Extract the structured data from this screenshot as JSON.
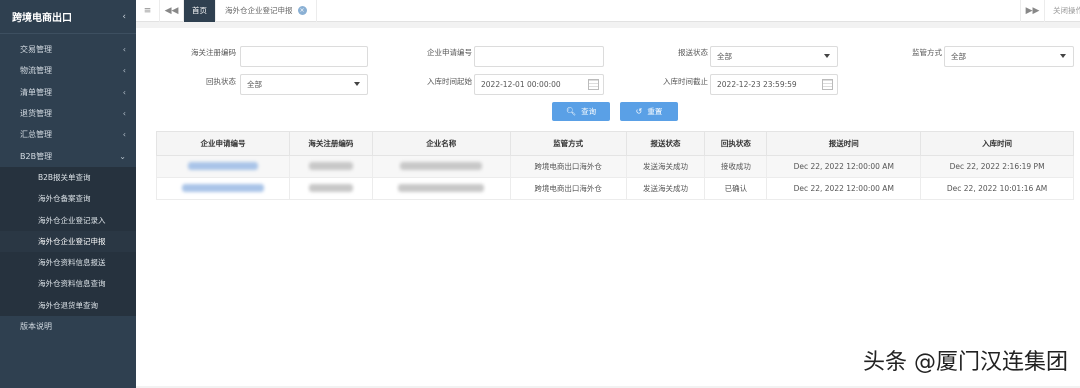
{
  "sidebar": {
    "title": "跨境电商出口",
    "menu": [
      {
        "label": "交易管理"
      },
      {
        "label": "物流管理"
      },
      {
        "label": "清单管理"
      },
      {
        "label": "退货管理"
      },
      {
        "label": "汇总管理"
      },
      {
        "label": "B2B管理"
      }
    ],
    "b2b_children": [
      {
        "label": "B2B报关单查询"
      },
      {
        "label": "海外仓备案查询"
      },
      {
        "label": "海外仓企业登记录入"
      },
      {
        "label": "海外仓企业登记申报"
      },
      {
        "label": "海外仓资料信息报送"
      },
      {
        "label": "海外仓资料信息查询"
      },
      {
        "label": "海外仓退货单查询"
      }
    ],
    "version": "版本说明"
  },
  "topbar": {
    "home_tab": "首页",
    "active_tab": "海外仓企业登记申报",
    "close_ops": "关闭操作"
  },
  "form": {
    "customs_code_label": "海关注册编码",
    "customs_code_value": "",
    "enterprise_no_label": "企业申请编号",
    "enterprise_no_value": "",
    "report_status_label": "报送状态",
    "report_status_value": "全部",
    "supervision_label": "监管方式",
    "supervision_value": "全部",
    "receipt_status_label": "回执状态",
    "receipt_status_value": "全部",
    "entry_start_label": "入库时间起始",
    "entry_start_value": "2022-12-01 00:00:00",
    "entry_end_label": "入库时间截止",
    "entry_end_value": "2022-12-23 23:59:59",
    "query_button": "查询",
    "reset_button": "重置"
  },
  "table": {
    "headers": [
      "企业申请编号",
      "海关注册编码",
      "企业名称",
      "监管方式",
      "报送状态",
      "回执状态",
      "报送时间",
      "入库时间"
    ],
    "rows": [
      {
        "supervision": "跨境电商出口海外仓",
        "report_status": "发送海关成功",
        "receipt_status": "接收成功",
        "report_time": "Dec 22, 2022 12:00:00 AM",
        "entry_time": "Dec 22, 2022 2:16:19 PM"
      },
      {
        "supervision": "跨境电商出口海外仓",
        "report_status": "发送海关成功",
        "receipt_status": "已确认",
        "report_time": "Dec 22, 2022 12:00:00 AM",
        "entry_time": "Dec 22, 2022 10:01:16 AM"
      }
    ]
  },
  "watermark": "头条 @厦门汉连集团"
}
